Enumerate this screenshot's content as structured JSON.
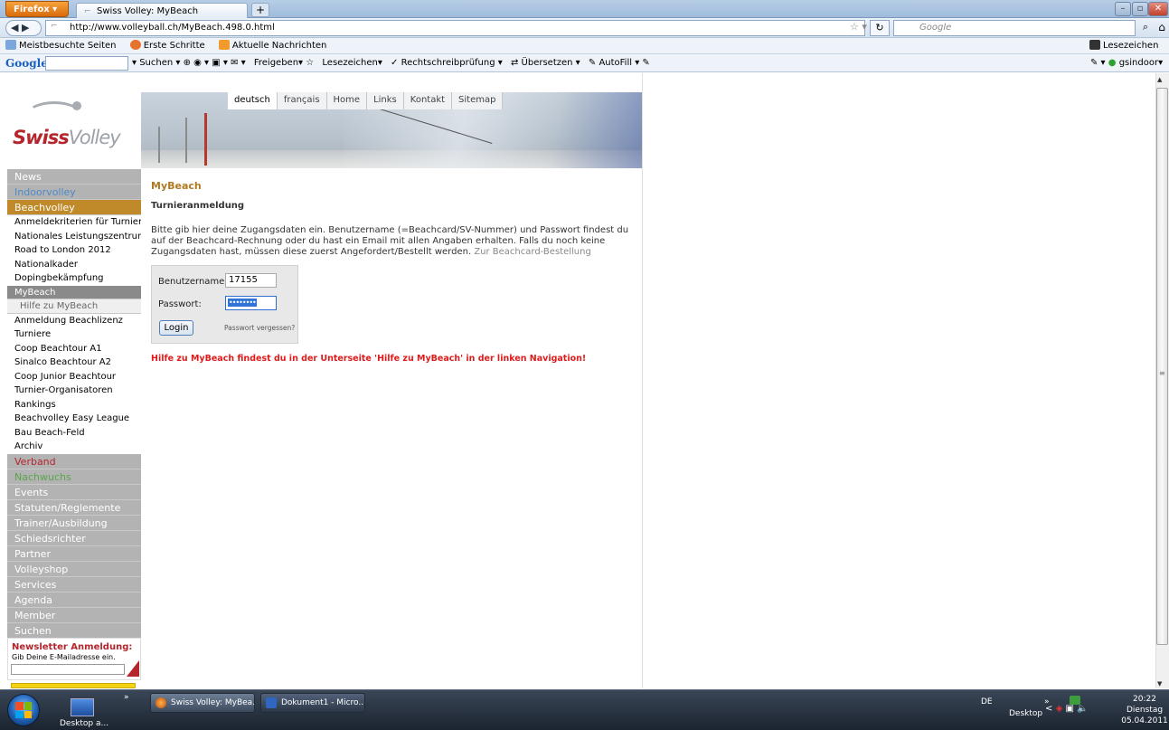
{
  "browser": {
    "menu_button": "Firefox",
    "tab_title": "Swiss Volley: MyBeach",
    "new_tab": "+",
    "url": "http://www.volleyball.ch/MyBeach.498.0.html",
    "search_engine": "Google",
    "bookmarks": [
      "Meistbesuchte Seiten",
      "Erste Schritte",
      "Aktuelle Nachrichten"
    ],
    "bookmarks_right": "Lesezeichen",
    "google_toolbar": {
      "logo": "Google",
      "items": [
        "Suchen",
        "Freigeben",
        "Lesezeichen",
        "Rechtschreibprüfung",
        "Übersetzen",
        "AutoFill"
      ],
      "user": "gsindoor"
    }
  },
  "site": {
    "logo_swiss": "Swiss",
    "logo_volley": "Volley",
    "top_nav": [
      "deutsch",
      "français",
      "Home",
      "Links",
      "Kontakt",
      "Sitemap"
    ],
    "left_nav": [
      {
        "label": "News",
        "style": "main"
      },
      {
        "label": "Indoorvolley",
        "style": "main blue"
      },
      {
        "label": "Beachvolley",
        "style": "main gold"
      },
      {
        "label": "Anmeldekriterien für Turniere",
        "style": "sub"
      },
      {
        "label": "Nationales Leistungszentrum",
        "style": "sub"
      },
      {
        "label": "Road to London 2012",
        "style": "sub"
      },
      {
        "label": "Nationalkader",
        "style": "sub"
      },
      {
        "label": "Dopingbekämpfung",
        "style": "sub"
      },
      {
        "label": "MyBeach",
        "style": "subsel"
      },
      {
        "label": "Hilfe zu MyBeach",
        "style": "subsub"
      },
      {
        "label": "Anmeldung Beachlizenz",
        "style": "sub"
      },
      {
        "label": "Turniere",
        "style": "sub"
      },
      {
        "label": "Coop Beachtour A1",
        "style": "sub"
      },
      {
        "label": "Sinalco Beachtour A2",
        "style": "sub"
      },
      {
        "label": "Coop Junior Beachtour",
        "style": "sub"
      },
      {
        "label": "Turnier-Organisatoren",
        "style": "sub"
      },
      {
        "label": "Rankings",
        "style": "sub"
      },
      {
        "label": "Beachvolley Easy League",
        "style": "sub"
      },
      {
        "label": "Bau Beach-Feld",
        "style": "sub"
      },
      {
        "label": "Archiv",
        "style": "sub"
      },
      {
        "label": "Verband",
        "style": "main red"
      },
      {
        "label": "Nachwuchs",
        "style": "main green"
      },
      {
        "label": "Events",
        "style": "main"
      },
      {
        "label": "Statuten/Reglemente",
        "style": "main"
      },
      {
        "label": "Trainer/Ausbildung",
        "style": "main"
      },
      {
        "label": "Schiedsrichter",
        "style": "main"
      },
      {
        "label": "Partner",
        "style": "main"
      },
      {
        "label": "Volleyshop",
        "style": "main"
      },
      {
        "label": "Services",
        "style": "main"
      },
      {
        "label": "Agenda",
        "style": "main"
      },
      {
        "label": "Member",
        "style": "main"
      },
      {
        "label": "Suchen",
        "style": "main"
      }
    ],
    "newsletter": {
      "title": "Newsletter Anmeldung:",
      "text": "Gib Deine E-Mailadresse ein."
    },
    "content": {
      "title": "MyBeach",
      "subtitle": "Turnieranmeldung",
      "text": "Bitte gib hier deine Zugangsdaten ein. Benutzername (=Beachcard/SV-Nummer) und Passwort findest du auf der Beachcard-Rechnung oder du hast ein Email mit allen Angaben erhalten. Falls du noch keine Zugangsdaten hast, müssen diese zuerst Angefordert/Bestellt werden.",
      "link": "Zur Beachcard-Bestellung",
      "login": {
        "user_label": "Benutzername:",
        "user_value": "17155",
        "pass_label": "Passwort:",
        "pass_value": "••••••••",
        "button": "Login",
        "forgot": "Passwort vergessen?"
      },
      "hint": "Hilfe zu MyBeach findest du in der Unterseite 'Hilfe zu MyBeach' in der linken Navigation!"
    }
  },
  "taskbar": {
    "desktop_label": "Desktop a...",
    "items": [
      "Swiss Volley: MyBea...",
      "Dokument1 - Micro..."
    ],
    "lang": "DE",
    "desktop": "Desktop",
    "time": "20:22",
    "day": "Dienstag",
    "date": "05.04.2011"
  }
}
